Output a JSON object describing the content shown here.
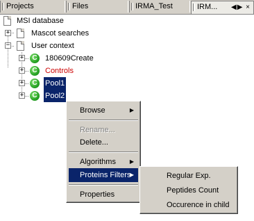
{
  "tabs": [
    {
      "label": "Projects"
    },
    {
      "label": "Files"
    },
    {
      "label": "IRMA_Test"
    },
    {
      "label": "IRM..."
    }
  ],
  "tab_controls": "◀▶ ×",
  "tree": {
    "root": {
      "label": "MSI database"
    },
    "items": [
      {
        "label": "Mascot searches"
      },
      {
        "label": "User context"
      },
      {
        "label": "180609Create"
      },
      {
        "label": "Controls"
      },
      {
        "label": "Pool1"
      },
      {
        "label": "Pool2"
      }
    ],
    "expander_symbols": {
      "plus": "+",
      "minus": "−"
    },
    "context_icon_letter": "C"
  },
  "context_menu": {
    "items": [
      {
        "label": "Browse"
      },
      {
        "label": "Rename..."
      },
      {
        "label": "Delete..."
      },
      {
        "label": "Algorithms"
      },
      {
        "label": "Proteins Filters"
      },
      {
        "label": "Properties"
      }
    ],
    "arrow": "▶"
  },
  "submenu": {
    "items": [
      {
        "label": "Regular Exp."
      },
      {
        "label": "Peptides Count"
      },
      {
        "label": "Occurence in child"
      }
    ]
  },
  "colors": {
    "selection": "#0a246a",
    "controls_text": "#cc0000",
    "menu_bg": "#d4d0c8"
  }
}
